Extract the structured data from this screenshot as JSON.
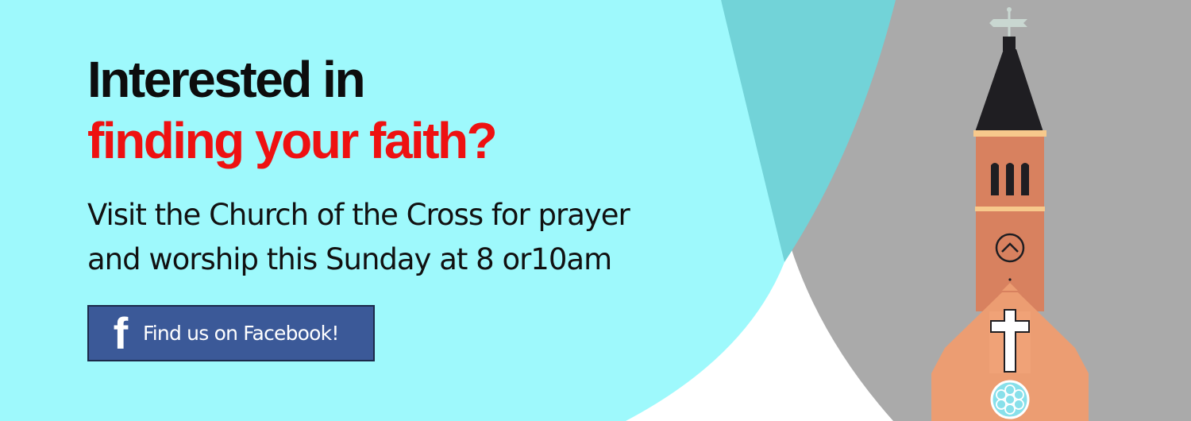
{
  "headline": {
    "line1": "Interested in",
    "line2": "finding your faith?"
  },
  "subheadline": {
    "line1": "Visit the Church of the Cross for prayer",
    "line2": "and worship this Sunday at 8 or10am"
  },
  "facebook_button": {
    "icon": "facebook-f-icon",
    "icon_glyph": "f",
    "label": "Find us on Facebook!"
  },
  "colors": {
    "background_light": "#9ef9fc",
    "background_teal": "#72d3d8",
    "background_gray": "#aaaaaa",
    "headline_black": "#0d0d0d",
    "headline_red": "#ee1111",
    "facebook_blue": "#3b5998",
    "steeple_roof": "#1f1e22",
    "tower_brick": "#d8815f",
    "facade": "#ec9d72"
  },
  "illustration": {
    "name": "church-steeple",
    "icons": [
      "weather-vane-icon",
      "clock-icon",
      "cross-icon",
      "rose-window-icon"
    ]
  }
}
